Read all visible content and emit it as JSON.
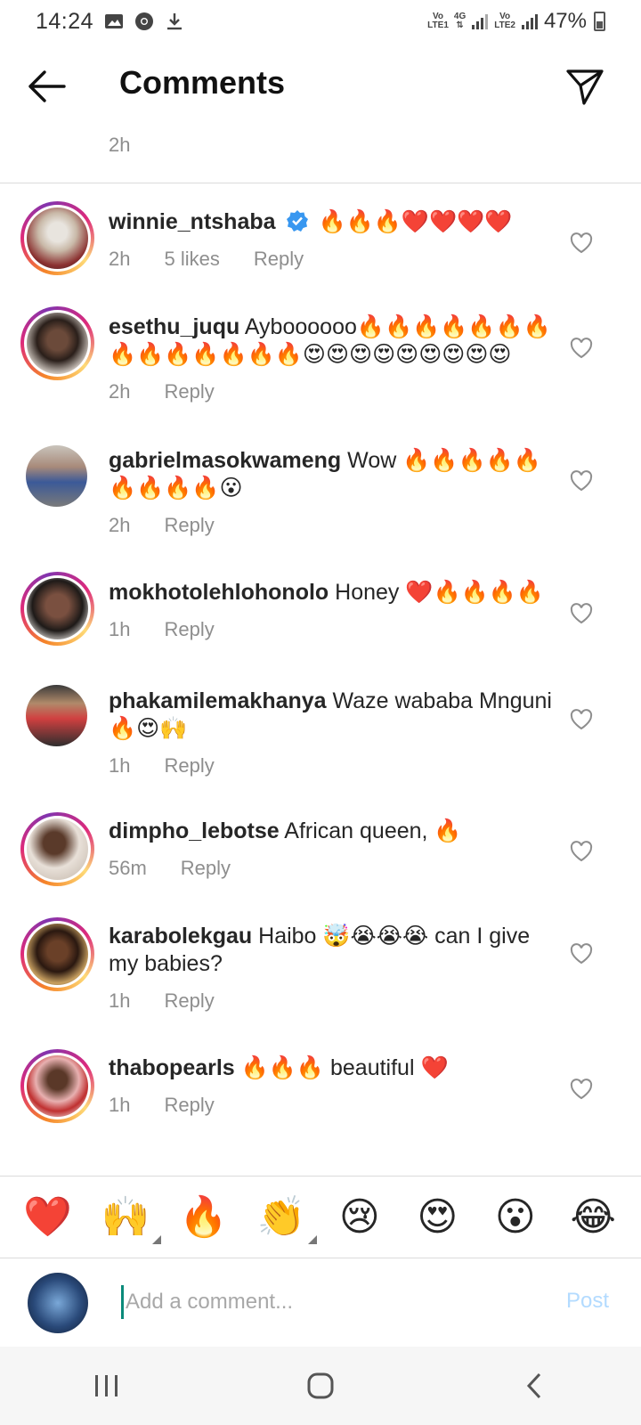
{
  "status_bar": {
    "time": "14:24",
    "battery": "47%",
    "net1_top": "Vo",
    "net1_bottom": "LTE1",
    "net2": "4G",
    "net3_top": "Vo",
    "net3_bottom": "LTE2"
  },
  "header": {
    "title": "Comments"
  },
  "prev_comment_time": "2h",
  "comments": [
    {
      "username": "winnie_ntshaba",
      "verified": true,
      "text": "🔥🔥🔥❤️❤️❤️❤️",
      "time": "2h",
      "likes": "5 likes",
      "reply": "Reply"
    },
    {
      "username": "esethu_juqu",
      "text": "Ayboooooo🔥🔥🔥🔥🔥🔥🔥🔥🔥🔥🔥🔥🔥🔥😍😍😍😍😍😍😍😍😍",
      "time": "2h",
      "reply": "Reply"
    },
    {
      "username": "gabrielmasokwameng",
      "text": "Wow 🔥🔥🔥🔥🔥🔥🔥🔥🔥😮",
      "time": "2h",
      "reply": "Reply"
    },
    {
      "username": "mokhotolehlohonolo",
      "text": "Honey ❤️🔥🔥🔥🔥",
      "time": "1h",
      "reply": "Reply"
    },
    {
      "username": "phakamilemakhanya",
      "text": "Waze wababa Mnguni 🔥😍🙌",
      "time": "1h",
      "reply": "Reply"
    },
    {
      "username": "dimpho_lebotse",
      "text": "African queen, 🔥",
      "time": "56m",
      "reply": "Reply"
    },
    {
      "username": "karabolekgau",
      "text": "Haibo 🤯😭😭😭 can I give my babies?",
      "time": "1h",
      "reply": "Reply"
    },
    {
      "username": "thabopearls",
      "text": "🔥🔥🔥 beautiful ❤️",
      "time": "1h",
      "reply": "Reply"
    }
  ],
  "quick_emojis": [
    "❤️",
    "🙌",
    "🔥",
    "👏",
    "😢",
    "😍",
    "😮",
    "😂"
  ],
  "composer": {
    "placeholder": "Add a comment...",
    "post_label": "Post"
  }
}
